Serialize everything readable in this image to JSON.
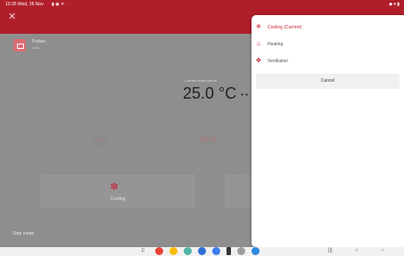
{
  "status_bar": {
    "time": "10:35  Wed, 26 Nov",
    "icons_left": "▮ ◉ ✕ ·",
    "icons_right": "◆ ▾ ▮"
  },
  "app_bar": {
    "close_icon": "close-icon"
  },
  "device": {
    "name": "Fodwo",
    "subtitle": "Salu"
  },
  "thermostat": {
    "current_label": "Current temperature",
    "current_value": "25.0 °C",
    "current_trailing": "• •",
    "minus_label": "–",
    "target_value": "23.0 °C"
  },
  "mode_card": {
    "label": "Cooling",
    "icon": "snowflake-icon"
  },
  "step_mode_label": "Step mode",
  "mode_sheet": {
    "options": [
      {
        "label": "Cooling (Current)",
        "icon": "snowflake-icon",
        "selected": true
      },
      {
        "label": "Heating",
        "icon": "flame-icon",
        "selected": false
      },
      {
        "label": "Ventilation",
        "icon": "fan-icon",
        "selected": false
      }
    ],
    "cancel_label": "Cancel"
  },
  "nav_bar": {
    "apps_icon": "grid-icon",
    "dock_colors": [
      "#e94335",
      "#fbbc04",
      "#4fb3a5",
      "#2f6fd6",
      "#3b7ff0",
      "#333333",
      "#9e9e9e",
      "#2d8ae0"
    ],
    "recents_label": "|||",
    "home_label": "○",
    "back_label": "‹"
  }
}
